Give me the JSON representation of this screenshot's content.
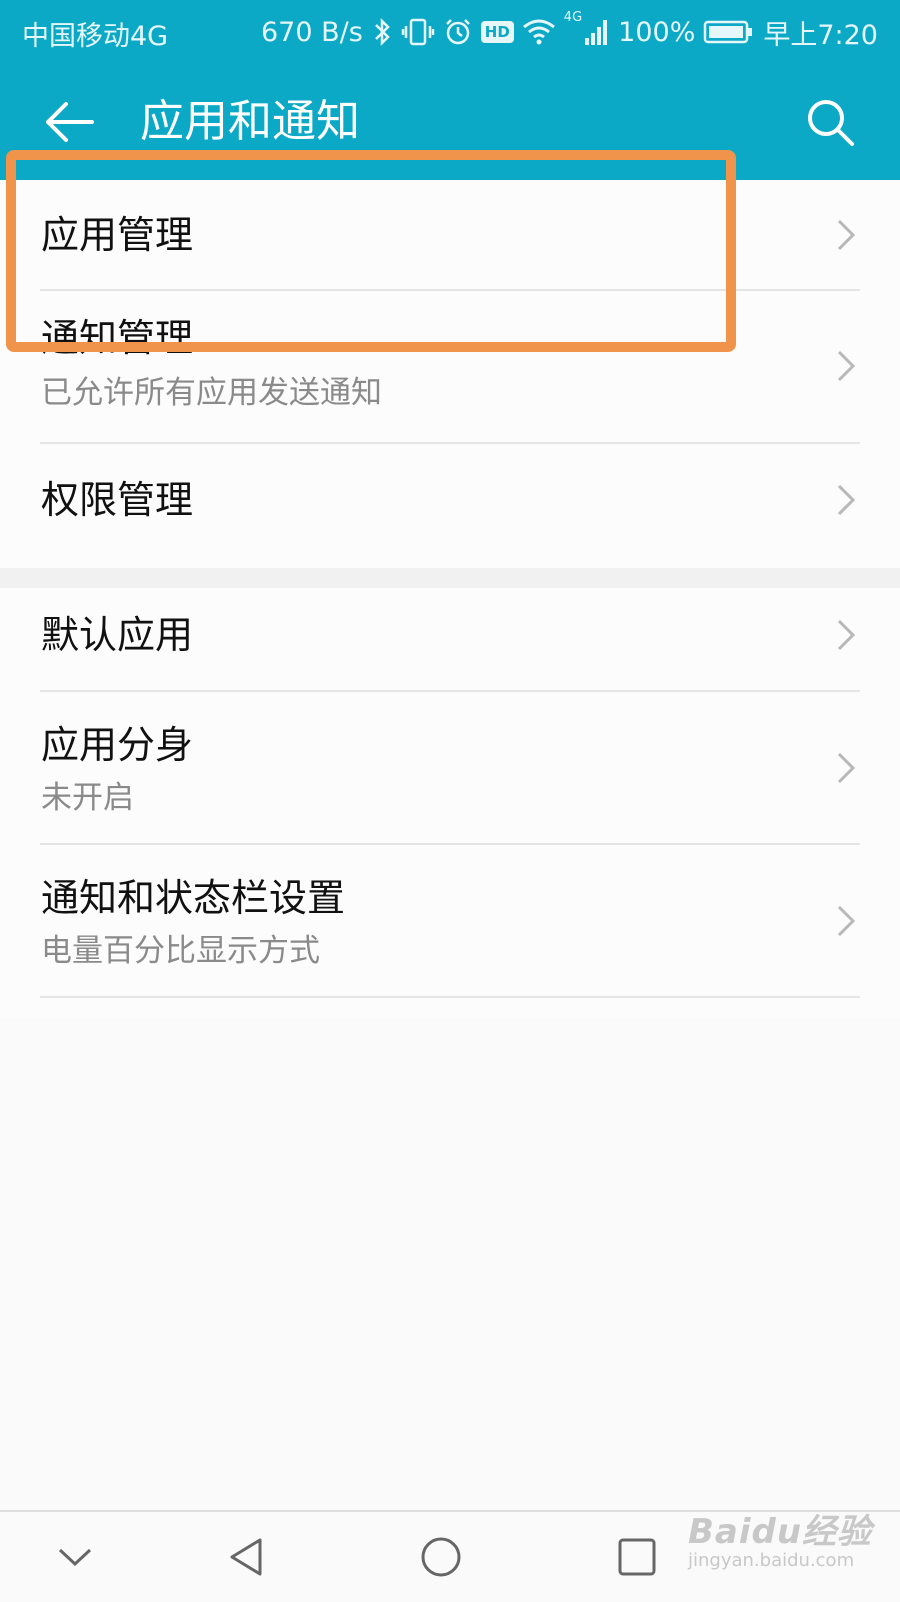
{
  "status_bar": {
    "carrier": "中国移动4G",
    "speed": "670 B/s",
    "hd": "HD",
    "network": "4G",
    "battery": "100%",
    "time": "早上7:20"
  },
  "app_bar": {
    "title": "应用和通知"
  },
  "groups": [
    {
      "items": [
        {
          "title": "应用管理",
          "subtitle": ""
        },
        {
          "title": "通知管理",
          "subtitle": "已允许所有应用发送通知"
        },
        {
          "title": "权限管理",
          "subtitle": ""
        }
      ]
    },
    {
      "items": [
        {
          "title": "默认应用",
          "subtitle": ""
        },
        {
          "title": "应用分身",
          "subtitle": "未开启"
        },
        {
          "title": "通知和状态栏设置",
          "subtitle": "电量百分比显示方式"
        }
      ]
    }
  ],
  "watermark": {
    "brand": "Baidu经验",
    "domain": "jingyan.baidu.com"
  },
  "colors": {
    "accent": "#0ba9c6",
    "highlight": "#f0944c"
  }
}
